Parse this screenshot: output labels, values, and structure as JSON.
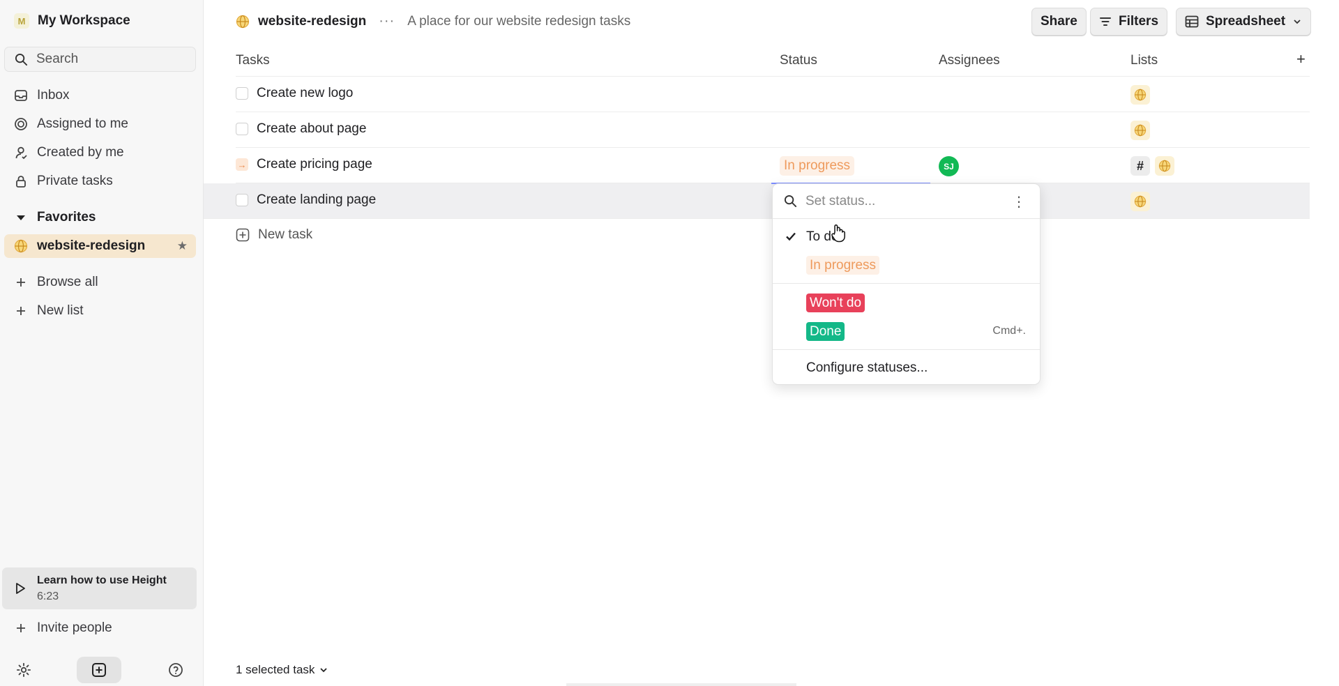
{
  "sidebar": {
    "workspace_initial": "M",
    "workspace_name": "My Workspace",
    "search_label": "Search",
    "nav": [
      {
        "label": "Inbox",
        "icon": "inbox-icon"
      },
      {
        "label": "Assigned to me",
        "icon": "target-icon"
      },
      {
        "label": "Created by me",
        "icon": "person-icon"
      },
      {
        "label": "Private tasks",
        "icon": "lock-icon"
      }
    ],
    "favorites_label": "Favorites",
    "favorite_item": "website-redesign",
    "browse_all": "Browse all",
    "new_list": "New list",
    "learn_title": "Learn how to use Height",
    "learn_duration": "6:23",
    "invite": "Invite people"
  },
  "header": {
    "project_name": "website-redesign",
    "more": "···",
    "description": "A place for our website redesign tasks",
    "share": "Share",
    "filters": "Filters",
    "view": "Spreadsheet"
  },
  "table": {
    "columns": {
      "tasks": "Tasks",
      "status": "Status",
      "assignees": "Assignees",
      "lists": "Lists",
      "add": "+"
    },
    "rows": [
      {
        "name": "Create new logo",
        "status": "",
        "assignee": ""
      },
      {
        "name": "Create about page",
        "status": "",
        "assignee": ""
      },
      {
        "name": "Create pricing page",
        "status": "In progress",
        "assignee": "SJ"
      },
      {
        "name": "Create landing page",
        "status": "",
        "assignee": ""
      }
    ],
    "new_task": "New task"
  },
  "status_dropdown": {
    "placeholder": "Set status...",
    "options": {
      "todo": "To do",
      "in_progress": "In progress",
      "wont_do": "Won't do",
      "done": "Done"
    },
    "done_shortcut": "Cmd+.",
    "configure": "Configure statuses..."
  },
  "footer": {
    "selection": "1 selected task"
  },
  "colors": {
    "accent_favorite": "#f6e7cf",
    "in_progress": "#ee9a5c",
    "wont_do": "#e8415a",
    "done": "#14b888",
    "avatar": "#12b955"
  }
}
